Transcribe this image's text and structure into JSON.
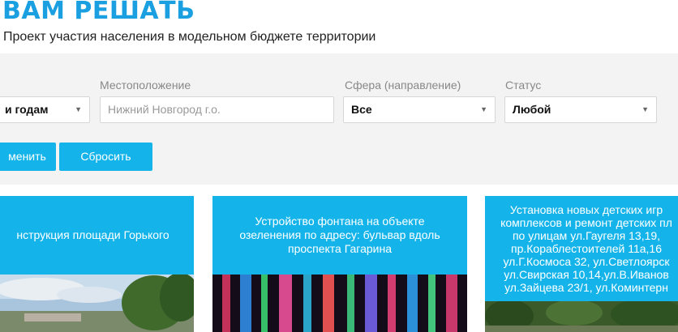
{
  "header": {
    "title": "ВАМ РЕШАТЬ",
    "subtitle": "Проект участия населения в модельном бюджете территории"
  },
  "filters": {
    "year": {
      "value": "и годам"
    },
    "location": {
      "label": "Местоположение",
      "placeholder": "Нижний Новгород г.о."
    },
    "sphere": {
      "label": "Сфера (направление)",
      "value": "Все"
    },
    "status": {
      "label": "Статус",
      "value": "Любой"
    }
  },
  "buttons": {
    "apply": "менить",
    "reset": "Сбросить"
  },
  "cards": [
    {
      "title": "нструкция площади Горького"
    },
    {
      "title": "Устройство фонтана на объекте\nозеленения по адресу: бульвар вдоль\nпроспекта Гагарина"
    },
    {
      "title": "Установка новых детских игр\nкомплексов и ремонт детских пл\nпо улицам ул.Гаугеля 13,19,\nпр.Кораблестоителей 11а,16\nул.Г.Космоса 32, ул.Светлоярск\nул.Свирская 10,14,ул.В.Иванов\nул.Зайцева 23/1, ул.Коминтерн"
    }
  ],
  "colors": {
    "accent": "#14b4ea",
    "title": "#1aa0e0",
    "panel": "#f3f3f3"
  },
  "icons": {
    "caret": "caret-down-icon"
  }
}
